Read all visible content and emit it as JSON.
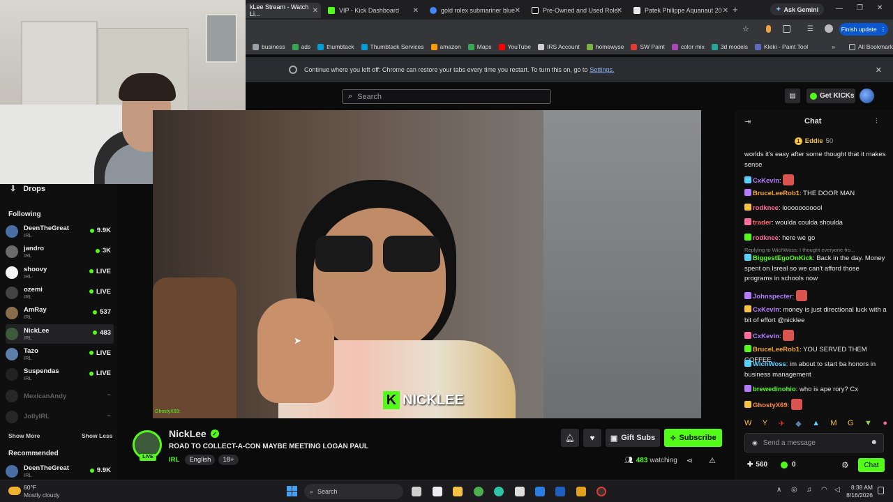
{
  "browser": {
    "tabs": [
      {
        "title": "kLee Stream - Watch Li...",
        "active": true,
        "color": "#53fc18"
      },
      {
        "title": "VIP - Kick Dashboard",
        "active": false,
        "color": "#53fc18"
      },
      {
        "title": "gold rolex submariner blue",
        "active": false,
        "color": "#4285f4"
      },
      {
        "title": "Pre-Owned and Used Role:",
        "active": false,
        "color": "#ffffff"
      },
      {
        "title": "Patek Philippe Aquanaut 20",
        "active": false,
        "color": "#e8e8e8"
      }
    ],
    "new_tab": "+",
    "ask_gemini": "Ask Gemini",
    "finish_update": "Finish update",
    "bookmarks": [
      {
        "label": "business",
        "color": "#9aa0a6"
      },
      {
        "label": "ads",
        "color": "#34a853"
      },
      {
        "label": "thumbtack",
        "color": "#009fd9"
      },
      {
        "label": "Thumbtack Services",
        "color": "#009fd9"
      },
      {
        "label": "amazon",
        "color": "#ff9900"
      },
      {
        "label": "Maps",
        "color": "#34a853"
      },
      {
        "label": "YouTube",
        "color": "#ff0000"
      },
      {
        "label": "IRS Account",
        "color": "#cfcfcf"
      },
      {
        "label": "homewyse",
        "color": "#7cb342"
      },
      {
        "label": "SW Paint",
        "color": "#e53935"
      },
      {
        "label": "color mix",
        "color": "#ab47bc"
      },
      {
        "label": "3d models",
        "color": "#26a69a"
      },
      {
        "label": "Kleki - Paint Tool",
        "color": "#5c6bc0"
      }
    ],
    "all_bookmarks": "All Bookmarks",
    "restore_text": "Continue where you left off: Chrome can restore your tabs every time you restart. To turn this on, go to",
    "restore_link": "Settings."
  },
  "kick": {
    "search_placeholder": "Search",
    "get_kicks": "Get KICKs"
  },
  "sidebar": {
    "drops": "Drops",
    "following_title": "Following",
    "following": [
      {
        "name": "DeenTheGreat",
        "category": "IRL",
        "count": "9.9K",
        "avatar": "#4a6fa5"
      },
      {
        "name": "jandro",
        "category": "IRL",
        "count": "3K",
        "avatar": "#6b6b6b"
      },
      {
        "name": "shoovy",
        "category": "IRL",
        "count": "LIVE",
        "avatar": "#f5f5f5"
      },
      {
        "name": "ozemi",
        "category": "IRL",
        "count": "LIVE",
        "avatar": "#444"
      },
      {
        "name": "AmRay",
        "category": "IRL",
        "count": "537",
        "avatar": "#8a6d4b"
      },
      {
        "name": "NickLee",
        "category": "IRL",
        "count": "483",
        "avatar": "#3d5a3a"
      },
      {
        "name": "Tazo",
        "category": "IRL",
        "count": "LIVE",
        "avatar": "#5b7fa8"
      },
      {
        "name": "Suspendas",
        "category": "IRL",
        "count": "LIVE",
        "avatar": "#222"
      }
    ],
    "offline": [
      {
        "name": "MexicanAndy"
      },
      {
        "name": "JollyIRL"
      }
    ],
    "show_more": "Show More",
    "show_less": "Show Less",
    "recommended_title": "Recommended",
    "recommended": [
      {
        "name": "DeenTheGreat",
        "category": "IRL",
        "count": "9.9K",
        "avatar": "#4a6fa5"
      }
    ]
  },
  "video": {
    "overlay_name": "NICKLEE",
    "corner_tag": "GhostyX69:"
  },
  "channel": {
    "name": "NickLee",
    "live": "LIVE",
    "title": "ROAD TO COLLECT-A-CON MAYBE MEETING LOGAN PAUL",
    "tags": [
      "IRL",
      "English",
      "18+"
    ],
    "gift_subs": "Gift Subs",
    "subscribe": "Subscribe",
    "watching_count": "483",
    "watching_label": "watching"
  },
  "chat": {
    "title": "Chat",
    "top_user": "Eddie",
    "top_score": "50",
    "messages": [
      {
        "user": "",
        "text": "worlds it's easy after some thought that it makes sense",
        "color": "#e6e6e6"
      },
      {
        "user": "CxKevin",
        "text": "",
        "color": "#b57bff",
        "emote": true
      },
      {
        "user": "BruceLeeRob1",
        "text": "THE DOOR MAN",
        "color": "#f5a623"
      },
      {
        "user": "rodknee",
        "text": "looooooooool",
        "color": "#ff6b9a"
      },
      {
        "user": "trader",
        "text": "woulda coulda shoulda",
        "color": "#ff6b6b"
      },
      {
        "user": "rodknee",
        "text": "here we go",
        "color": "#ff6b9a"
      },
      {
        "user": "BiggestEgoOnKick",
        "text": "Back in the day. Money spent on Isreal so we can't afford those programs in schools now",
        "color": "#53fc18",
        "reply": "Replying to WichWoss: I thought everyone fro..."
      },
      {
        "user": "Johnspecter",
        "text": "",
        "color": "#b57bff",
        "emote": true
      },
      {
        "user": "CxKevin",
        "text": "money is just directional luck with a bit of effort @nicklee",
        "color": "#b57bff"
      },
      {
        "user": "CxKevin",
        "text": "",
        "color": "#b57bff",
        "emote": true
      },
      {
        "user": "BruceLeeRob1",
        "text": "YOU SERVED THEM COFFEE",
        "color": "#f5a623"
      },
      {
        "user": "WichWoss",
        "text": "im about to start ba honors in business management",
        "color": "#5ad1ff"
      },
      {
        "user": "brewedinohio",
        "text": "who is ape rory? Cx",
        "color": "#53fc18"
      },
      {
        "user": "GhostyX69",
        "text": "",
        "color": "#ff8a3d",
        "emote": true
      }
    ],
    "send_placeholder": "Send a message",
    "points": "560",
    "kicks": "0",
    "chat_button": "Chat"
  },
  "taskbar": {
    "temp": "60°F",
    "weather": "Mostly cloudy",
    "search": "Search",
    "time": "8:38 AM",
    "date": "8/16/2026"
  }
}
